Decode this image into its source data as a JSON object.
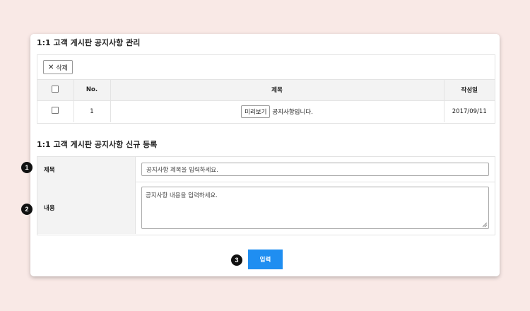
{
  "list_section": {
    "title": "1:1 고객 게시판 공지사항 관리",
    "delete_label": "삭제",
    "columns": {
      "no": "No.",
      "title": "제목",
      "date": "작성일"
    },
    "rows": [
      {
        "no": "1",
        "preview_label": "미리보기",
        "title": "공지사항입니다.",
        "date": "2017/09/11"
      }
    ]
  },
  "form_section": {
    "title": "1:1 고객 게시판 공지사항 신규 등록",
    "title_label": "제목",
    "title_placeholder": "공지사항 제목을 입력하세요.",
    "content_label": "내용",
    "content_placeholder": "공지사항 내용을 입력하세요.",
    "submit_label": "입력"
  },
  "badges": [
    "1",
    "2",
    "3"
  ],
  "colors": {
    "accent": "#1f8ef1",
    "background": "#f9e9e6"
  }
}
